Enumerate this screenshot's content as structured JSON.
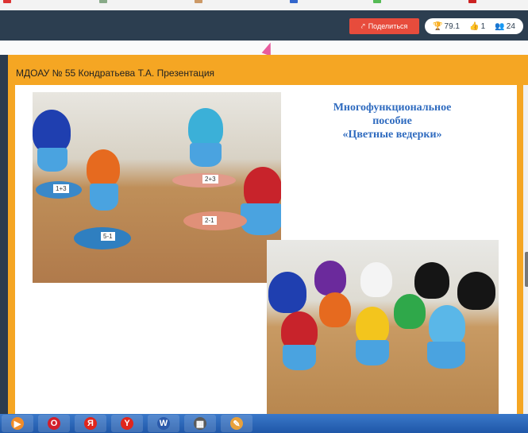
{
  "share": {
    "label": "Поделиться"
  },
  "stats": {
    "rating": "79.1",
    "likes": "1",
    "viewers": "24"
  },
  "presentation": {
    "title": "МДОАУ № 55 Кондратьева Т.А. Презентация",
    "slide_text_lines": [
      "Многофункциональное",
      "пособие",
      "«Цветные ведерки»"
    ]
  },
  "photo_labels": [
    "1+3",
    "2+3",
    "2-1",
    "5-1"
  ],
  "taskbar": {
    "items": [
      {
        "name": "vlc",
        "glyph": "▶",
        "color": "#f28c28"
      },
      {
        "name": "opera",
        "glyph": "O",
        "color": "#d21f2b"
      },
      {
        "name": "yandex",
        "glyph": "Я",
        "color": "#e0261d"
      },
      {
        "name": "yandex-browser",
        "glyph": "Y",
        "color": "#e0261d"
      },
      {
        "name": "word",
        "glyph": "W",
        "color": "#2b5aab"
      },
      {
        "name": "video",
        "glyph": "▦",
        "color": "#5a5a5a"
      },
      {
        "name": "paint",
        "glyph": "✎",
        "color": "#e8a13b"
      }
    ]
  }
}
